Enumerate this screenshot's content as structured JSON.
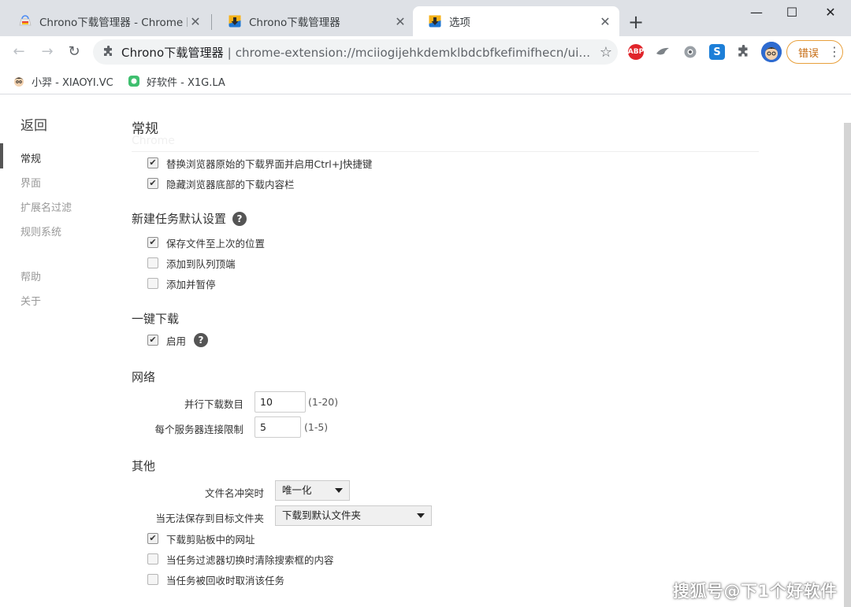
{
  "tabs": [
    {
      "title": "Chrono下载管理器 - Chrome 网",
      "favicon": "chrome-web-store-icon"
    },
    {
      "title": "Chrono下载管理器",
      "favicon": "chrono-download-icon"
    },
    {
      "title": "选项",
      "favicon": "chrono-download-icon",
      "active": true
    }
  ],
  "window": {
    "minimize": "—",
    "maximize": "☐",
    "close": "✕"
  },
  "omnibox": {
    "site": "Chrono下载管理器",
    "separator": "|",
    "url": "chrome-extension://mciiogijehkdemklbdcbfkefimifhecn/ui..."
  },
  "extensions": [
    {
      "name": "adblock-icon",
      "label": "ABP",
      "color": "#e0242a"
    },
    {
      "name": "bird-extension-icon",
      "label": "",
      "color": "#8a8f94"
    },
    {
      "name": "shield-extension-icon",
      "label": "",
      "color": "#8a8f94"
    },
    {
      "name": "s-extension-icon",
      "label": "S",
      "color": "#1d7fd8"
    },
    {
      "name": "puzzle-extensions-icon",
      "label": "",
      "color": "#5f6368"
    }
  ],
  "error_button": {
    "label": "错误"
  },
  "bookmarks": [
    {
      "label": "小羿 - XIAOYI.VC"
    },
    {
      "label": "好软件 - X1G.LA"
    }
  ],
  "sidebar": {
    "back": "返回",
    "items": [
      "常规",
      "界面",
      "扩展名过滤",
      "规则系统",
      "帮助",
      "关于"
    ]
  },
  "general": {
    "title": "常规",
    "ghost": "Chrome",
    "options": [
      {
        "label": "替换浏览器原始的下载界面并启用Ctrl+J快捷键",
        "checked": true
      },
      {
        "label": "隐藏浏览器底部的下载内容栏",
        "checked": true
      }
    ]
  },
  "new_task": {
    "title": "新建任务默认设置",
    "options": [
      {
        "label": "保存文件至上次的位置",
        "checked": true
      },
      {
        "label": "添加到队列顶端",
        "checked": false
      },
      {
        "label": "添加并暂停",
        "checked": false
      }
    ]
  },
  "one_click": {
    "title": "一键下载",
    "options": [
      {
        "label": "启用",
        "checked": true
      }
    ]
  },
  "network": {
    "title": "网络",
    "parallel_label": "并行下载数目",
    "parallel_value": "10",
    "parallel_hint": "(1-20)",
    "per_server_label": "每个服务器连接限制",
    "per_server_value": "5",
    "per_server_hint": "(1-5)"
  },
  "other": {
    "title": "其他",
    "conflict_label": "文件名冲突时",
    "conflict_value": "唯一化",
    "cannot_save_label": "当无法保存到目标文件夹",
    "cannot_save_value": "下载到默认文件夹",
    "options": [
      {
        "label": "下载剪贴板中的网址",
        "checked": true
      },
      {
        "label": "当任务过滤器切换时清除搜索框的内容",
        "checked": false
      },
      {
        "label": "当任务被回收时取消该任务",
        "checked": false
      }
    ]
  },
  "watermark": "搜狐号@下1个好软件"
}
